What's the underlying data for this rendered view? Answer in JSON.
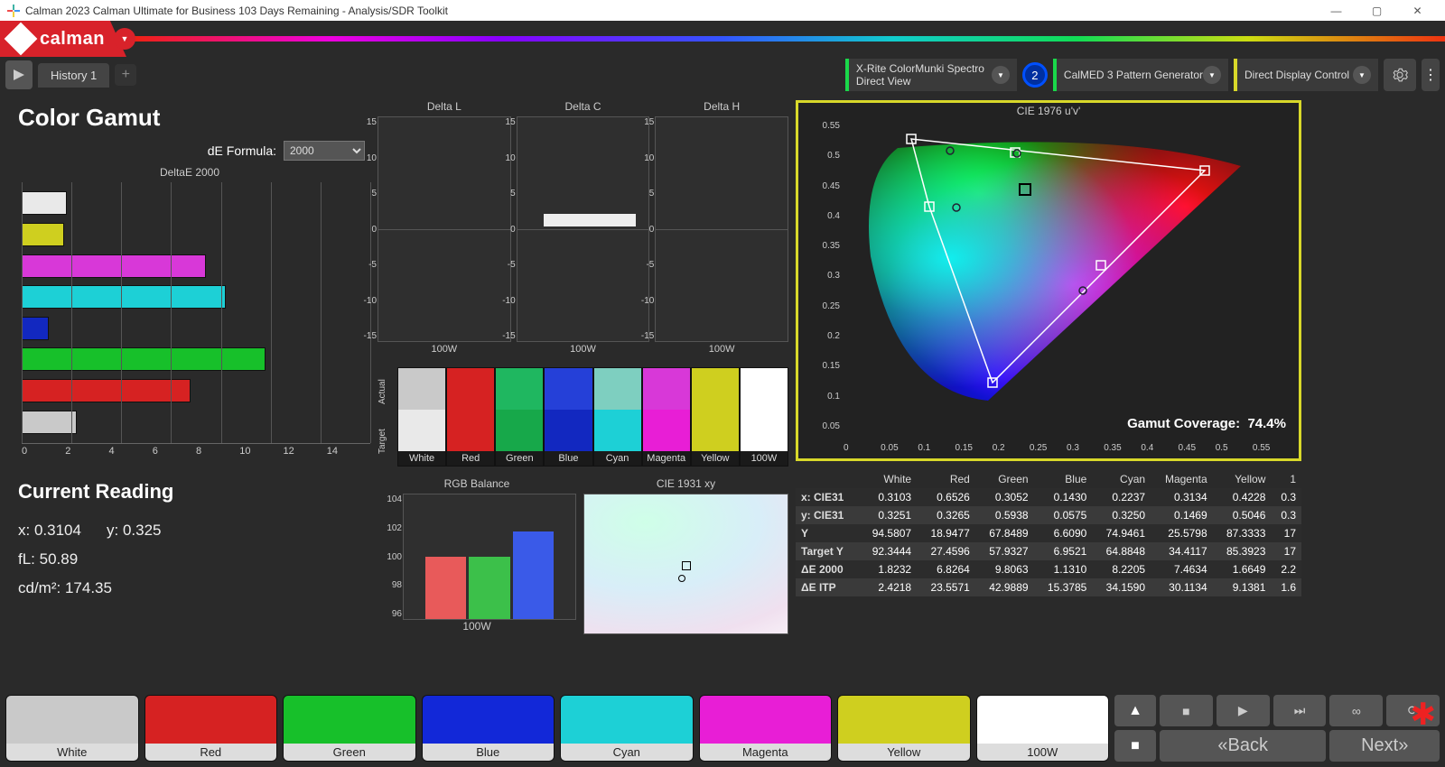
{
  "window": {
    "title": "Calman 2023 Calman Ultimate for Business 103 Days Remaining  - Analysis/SDR Toolkit"
  },
  "brand": {
    "name": "calman"
  },
  "tabs": {
    "history": "History 1"
  },
  "devices": {
    "meter": {
      "line1": "X-Rite ColorMunki Spectro",
      "line2": "Direct View",
      "accent": "#1ad84a"
    },
    "circle_num": "2",
    "source": {
      "line1": "CalMED 3 Pattern Generator",
      "accent": "#1ad84a"
    },
    "display": {
      "line1": "Direct Display Control",
      "accent": "#d8d82a"
    }
  },
  "gamut": {
    "title": "Color Gamut",
    "de_label": "dE Formula:",
    "de_value": "2000",
    "chart_title": "DeltaE 2000"
  },
  "mini": {
    "l": "Delta L",
    "c": "Delta C",
    "h": "Delta H",
    "xl": "100W",
    "ticks": [
      "15",
      "10",
      "5",
      "0",
      "-5",
      "-10",
      "-15"
    ]
  },
  "swatch_side": {
    "actual": "Actual",
    "target": "Target"
  },
  "swatches": [
    {
      "name": "White",
      "actual": "#c9c9c9",
      "target": "#e9e9e9"
    },
    {
      "name": "Red",
      "actual": "#d62222",
      "target": "#d62222"
    },
    {
      "name": "Green",
      "actual": "#1fb760",
      "target": "#17a84a"
    },
    {
      "name": "Blue",
      "actual": "#2540d8",
      "target": "#1228c0"
    },
    {
      "name": "Cyan",
      "actual": "#7ecfc0",
      "target": "#1dd0d6"
    },
    {
      "name": "Magenta",
      "actual": "#d838d8",
      "target": "#e81ed6"
    },
    {
      "name": "Yellow",
      "actual": "#cfcf1f",
      "target": "#cfcf1f"
    },
    {
      "name": "100W",
      "actual": "#ffffff",
      "target": "#ffffff"
    }
  ],
  "rgb": {
    "title": "RGB Balance",
    "xl": "100W",
    "ticks": [
      "104",
      "102",
      "100",
      "98",
      "96"
    ]
  },
  "cie1931": {
    "title": "CIE 1931 xy"
  },
  "cie_big": {
    "title": "CIE 1976 u'v'",
    "coverage_label": "Gamut Coverage:",
    "coverage_value": "74.4%",
    "xticks": [
      "0",
      "0.05",
      "0.1",
      "0.15",
      "0.2",
      "0.25",
      "0.3",
      "0.35",
      "0.4",
      "0.45",
      "0.5",
      "0.55"
    ],
    "yticks": [
      "0.05",
      "0.1",
      "0.15",
      "0.2",
      "0.25",
      "0.3",
      "0.35",
      "0.4",
      "0.45",
      "0.5",
      "0.55"
    ]
  },
  "reading": {
    "title": "Current Reading",
    "x_label": "x:",
    "x_val": "0.3104",
    "y_label": "y:",
    "y_val": "0.325",
    "fl_label": "fL:",
    "fl_val": "50.89",
    "cd_label": "cd/m²:",
    "cd_val": "174.35"
  },
  "table": {
    "cols": [
      "",
      "White",
      "Red",
      "Green",
      "Blue",
      "Cyan",
      "Magenta",
      "Yellow",
      "1"
    ],
    "rows": [
      [
        "x: CIE31",
        "0.3103",
        "0.6526",
        "0.3052",
        "0.1430",
        "0.2237",
        "0.3134",
        "0.4228",
        "0.3"
      ],
      [
        "y: CIE31",
        "0.3251",
        "0.3265",
        "0.5938",
        "0.0575",
        "0.3250",
        "0.1469",
        "0.5046",
        "0.3"
      ],
      [
        "Y",
        "94.5807",
        "18.9477",
        "67.8489",
        "6.6090",
        "74.9461",
        "25.5798",
        "87.3333",
        "17"
      ],
      [
        "Target Y",
        "92.3444",
        "27.4596",
        "57.9327",
        "6.9521",
        "64.8848",
        "34.4117",
        "85.3923",
        "17"
      ],
      [
        "ΔE 2000",
        "1.8232",
        "6.8264",
        "9.8063",
        "1.1310",
        "8.2205",
        "7.4634",
        "1.6649",
        "2.2"
      ],
      [
        "ΔE ITP",
        "2.4218",
        "23.5571",
        "42.9889",
        "15.3785",
        "34.1590",
        "30.1134",
        "9.1381",
        "1.6"
      ]
    ]
  },
  "footer_colors": [
    {
      "name": "White",
      "fill": "#c9c9c9"
    },
    {
      "name": "Red",
      "fill": "#d62222"
    },
    {
      "name": "Green",
      "fill": "#17c02a"
    },
    {
      "name": "Blue",
      "fill": "#1228d8"
    },
    {
      "name": "Cyan",
      "fill": "#1dd0d6"
    },
    {
      "name": "Magenta",
      "fill": "#e81ed6"
    },
    {
      "name": "Yellow",
      "fill": "#cfcf1f"
    },
    {
      "name": "100W",
      "fill": "#ffffff"
    }
  ],
  "nav": {
    "back": "Back",
    "next": "Next"
  },
  "chart_data": {
    "deltaE2000_bars": {
      "type": "bar-horizontal",
      "xlim": [
        0,
        14
      ],
      "categories": [
        "White",
        "Yellow",
        "Magenta",
        "Cyan",
        "Blue",
        "Green",
        "Red",
        "100W"
      ],
      "values": [
        1.8,
        1.7,
        7.4,
        8.2,
        1.1,
        9.8,
        6.8,
        2.2
      ],
      "colors": [
        "#e9e9e9",
        "#cfcf1f",
        "#d838d8",
        "#1dd0d6",
        "#1228c0",
        "#17c02a",
        "#d62222",
        "#c9c9c9"
      ]
    },
    "deltaL": {
      "type": "bar",
      "categories": [
        "100W"
      ],
      "values": [
        0
      ],
      "ylim": [
        -15,
        15
      ]
    },
    "deltaC": {
      "type": "bar",
      "categories": [
        "100W"
      ],
      "values": [
        2
      ],
      "ylim": [
        -15,
        15
      ]
    },
    "deltaH": {
      "type": "bar",
      "categories": [
        "100W"
      ],
      "values": [
        0
      ],
      "ylim": [
        -15,
        15
      ]
    },
    "rgb_balance": {
      "type": "bar",
      "categories": [
        "R",
        "G",
        "B"
      ],
      "values": [
        100,
        100,
        102
      ],
      "colors": [
        "#e85a5a",
        "#3cc04a",
        "#3a5ae8"
      ],
      "ylim": [
        95,
        105
      ]
    }
  }
}
